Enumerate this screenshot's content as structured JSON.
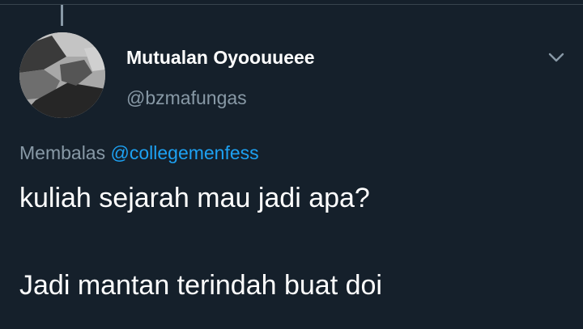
{
  "tweet": {
    "display_name": "Mutualan Oyoouueee",
    "handle": "@bzmafungas",
    "reply_prefix": "Membalas",
    "reply_mention": "@collegemenfess",
    "text_lines": [
      "kuliah sejarah mau jadi apa?",
      "Jadi mantan terindah buat doi"
    ]
  },
  "icons": {
    "more_menu": "chevron-down-icon",
    "avatar": "profile-avatar"
  },
  "colors": {
    "background": "#15202b",
    "text_primary": "#ffffff",
    "text_secondary": "#8899a6",
    "link": "#1da1f2",
    "divider": "#38444d"
  }
}
